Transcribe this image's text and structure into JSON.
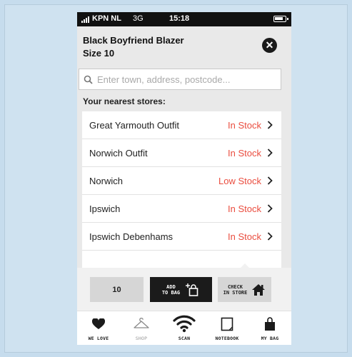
{
  "status_bar": {
    "carrier": "KPN NL",
    "network": "3G",
    "time": "15:18"
  },
  "product": {
    "name": "Black Boyfriend Blazer",
    "size": "Size 10"
  },
  "search": {
    "placeholder": "Enter town, address, postcode..."
  },
  "stores_heading": "Your nearest stores:",
  "stores": [
    {
      "name": "Great Yarmouth Outfit",
      "stock": "In Stock"
    },
    {
      "name": "Norwich Outfit",
      "stock": "In Stock"
    },
    {
      "name": "Norwich",
      "stock": "Low Stock"
    },
    {
      "name": "Ipswich",
      "stock": "In Stock"
    },
    {
      "name": "Ipswich Debenhams",
      "stock": "In Stock"
    }
  ],
  "actions": {
    "size_value": "10",
    "add_to_bag_line1": "ADD",
    "add_to_bag_line2": "TO BAG",
    "check_store_line1": "CHECK",
    "check_store_line2": "IN STORE"
  },
  "tabs": [
    {
      "label": "WE LOVE",
      "icon": "heart-icon"
    },
    {
      "label": "SHOP",
      "icon": "hanger-icon"
    },
    {
      "label": "SCAN",
      "icon": "wifi-scan-icon"
    },
    {
      "label": "NOTEBOOK",
      "icon": "notebook-icon"
    },
    {
      "label": "MY BAG",
      "icon": "bag-icon"
    }
  ],
  "colors": {
    "stock_red": "#ea4d3f",
    "dark": "#1b1b1b",
    "backdrop": "#c6dced"
  }
}
